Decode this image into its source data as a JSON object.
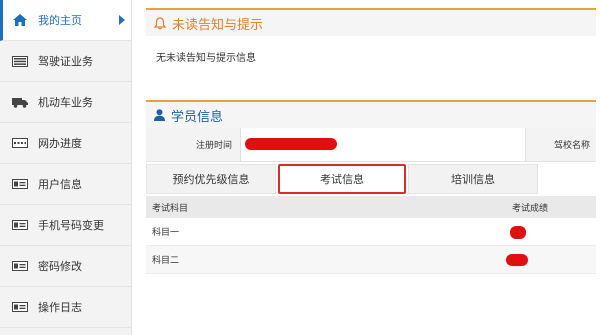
{
  "sidebar": {
    "items": [
      {
        "label": "我的主页",
        "icon": "home-icon"
      },
      {
        "label": "驾驶证业务",
        "icon": "license-card-icon"
      },
      {
        "label": "机动车业务",
        "icon": "truck-icon"
      },
      {
        "label": "网办进度",
        "icon": "progress-icon"
      },
      {
        "label": "用户信息",
        "icon": "user-card-icon"
      },
      {
        "label": "手机号码变更",
        "icon": "phone-card-icon"
      },
      {
        "label": "密码修改",
        "icon": "password-card-icon"
      },
      {
        "label": "操作日志",
        "icon": "log-card-icon"
      }
    ]
  },
  "notice": {
    "title": "未读告知与提示",
    "message": "无未读告知与提示信息",
    "icon": "bell-icon"
  },
  "student": {
    "title": "学员信息",
    "icon": "user-icon",
    "register_label": "注册时间",
    "school_label": "驾校名称"
  },
  "tabs": [
    {
      "label": "预约优先级信息"
    },
    {
      "label": "考试信息"
    },
    {
      "label": "培训信息"
    }
  ],
  "exam_table": {
    "headers": [
      "考试科目",
      "考试成绩"
    ],
    "rows": [
      {
        "subject": "科目一"
      },
      {
        "subject": "科目二"
      }
    ]
  },
  "colors": {
    "accent_blue": "#1f6fbf",
    "notice_orange": "#e0802a",
    "highlight_red": "#d62c2c"
  }
}
